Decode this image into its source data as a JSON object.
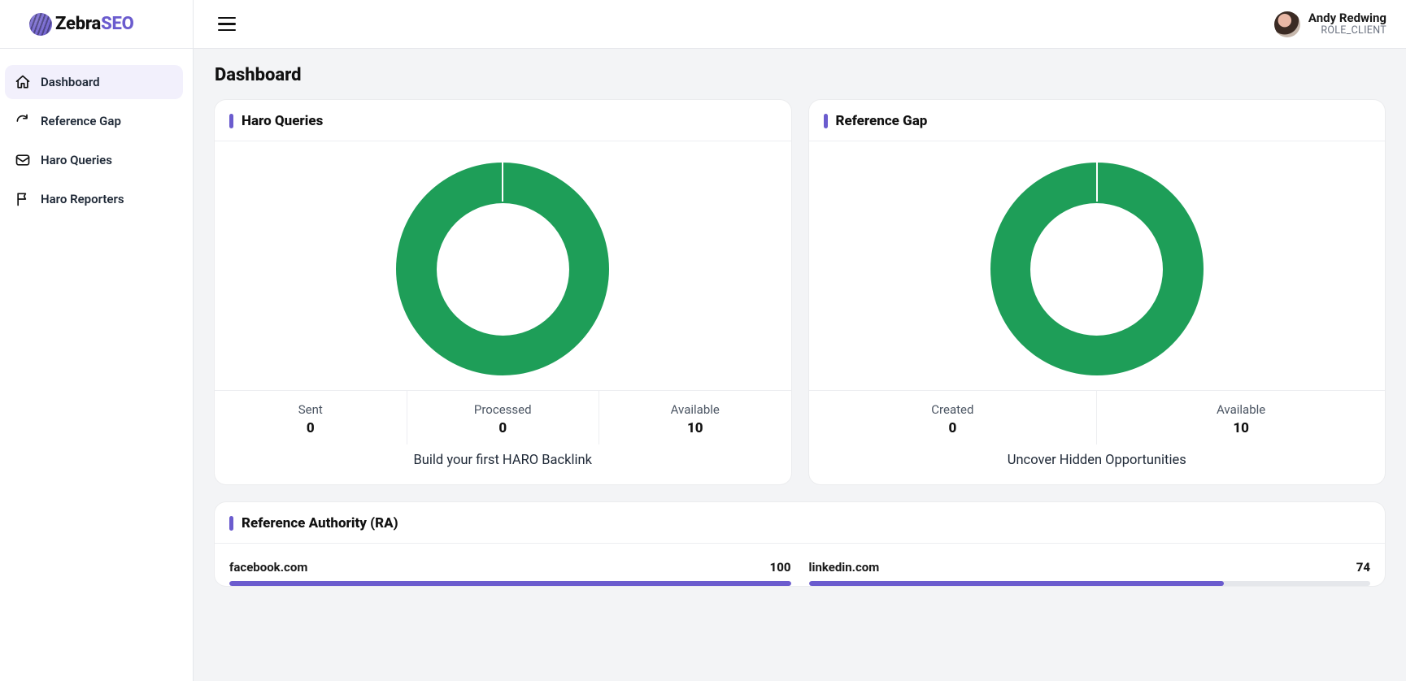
{
  "brand": {
    "zebra": "Zebra",
    "seo": "SEO"
  },
  "user": {
    "name": "Andy Redwing",
    "role": "ROLE_CLIENT"
  },
  "sidebar": {
    "items": [
      {
        "label": "Dashboard"
      },
      {
        "label": "Reference Gap"
      },
      {
        "label": "Haro Queries"
      },
      {
        "label": "Haro Reporters"
      }
    ]
  },
  "page": {
    "title": "Dashboard"
  },
  "cards": {
    "haro": {
      "title": "Haro Queries",
      "stats": [
        {
          "label": "Sent",
          "value": "0"
        },
        {
          "label": "Processed",
          "value": "0"
        },
        {
          "label": "Available",
          "value": "10"
        }
      ],
      "cta": "Build your first HARO Backlink"
    },
    "refgap": {
      "title": "Reference Gap",
      "stats": [
        {
          "label": "Created",
          "value": "0"
        },
        {
          "label": "Available",
          "value": "10"
        }
      ],
      "cta": "Uncover Hidden Opportunities"
    }
  },
  "ra": {
    "title": "Reference Authority (RA)",
    "items": [
      {
        "domain": "facebook.com",
        "score": "100",
        "pct": 100
      },
      {
        "domain": "linkedin.com",
        "score": "74",
        "pct": 74
      }
    ]
  },
  "chart_data": [
    {
      "type": "pie",
      "title": "Haro Queries",
      "series": [
        {
          "name": "Available",
          "value": 10
        },
        {
          "name": "Sent",
          "value": 0
        },
        {
          "name": "Processed",
          "value": 0
        }
      ],
      "colors": [
        "#1e9e58"
      ]
    },
    {
      "type": "pie",
      "title": "Reference Gap",
      "series": [
        {
          "name": "Available",
          "value": 10
        },
        {
          "name": "Created",
          "value": 0
        }
      ],
      "colors": [
        "#1e9e58"
      ]
    },
    {
      "type": "bar",
      "title": "Reference Authority (RA)",
      "categories": [
        "facebook.com",
        "linkedin.com"
      ],
      "values": [
        100,
        74
      ],
      "xlabel": "",
      "ylabel": "RA",
      "ylim": [
        0,
        100
      ]
    }
  ]
}
